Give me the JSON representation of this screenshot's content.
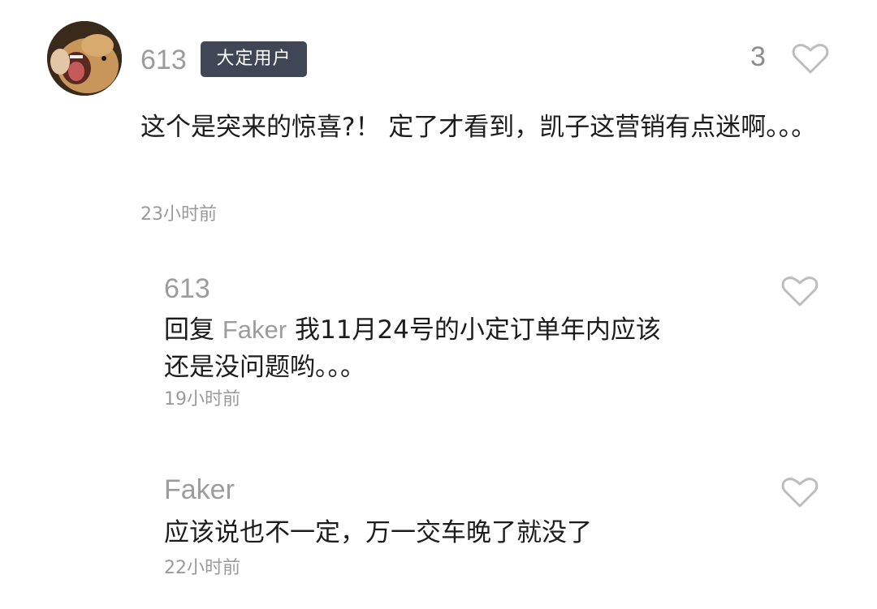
{
  "main_comment": {
    "username": "613",
    "badge": "大定用户",
    "like_count": "3",
    "text": "这个是突来的惊喜?！ 定了才看到，凯子这营销有点迷啊。。。",
    "timestamp": "23小时前"
  },
  "replies": [
    {
      "username": "613",
      "reply_prefix": "回复",
      "mention": "Faker",
      "text_line1": "我11月24号的小定订单年内应该",
      "text_line2": "还是没问题哟。。。",
      "timestamp": "19小时前"
    },
    {
      "username": "Faker",
      "text": "应该说也不一定，万一交车晚了就没了",
      "timestamp": "22小时前"
    }
  ],
  "icons": {
    "like": "heart-outline-icon",
    "avatar": "shiba-dog-avatar"
  },
  "colors": {
    "badge_bg": "#3f4756",
    "username": "#9c9c9c",
    "text": "#1c1c1c",
    "timestamp": "#9a9a9a",
    "heart_stroke": "#bdbdbd"
  }
}
